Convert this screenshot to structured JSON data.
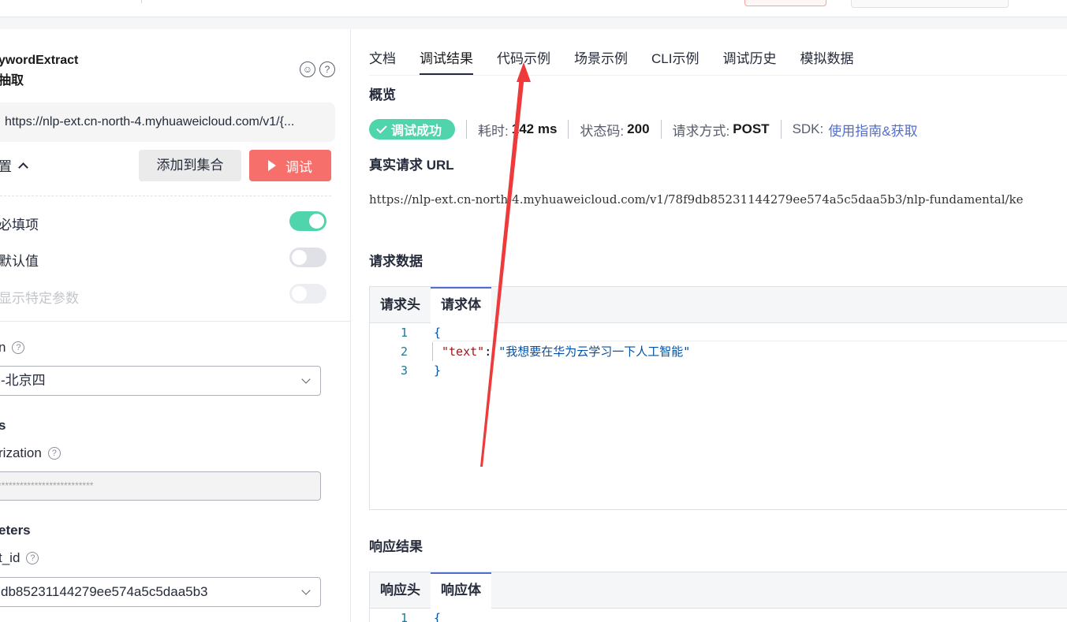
{
  "left": {
    "api_name_line1": "ywordExtract",
    "api_name_line2": "抽取",
    "url": "https://nlp-ext.cn-north-4.myhuaweicloud.com/v1/{...",
    "config_label": "置",
    "add_to_collection": "添加到集合",
    "debug": "调试",
    "toggles": [
      {
        "label": "必填项",
        "state": "on"
      },
      {
        "label": "默认值",
        "state": "off"
      },
      {
        "label": "显示特定参数",
        "state": "disabled"
      }
    ],
    "region_label": "n",
    "region_value": "-北京四",
    "headers_title": "s",
    "auth_label": "rization",
    "auth_value": "**************************",
    "params_title": "eters",
    "project_label": "t_id",
    "project_value": "db85231144279ee574a5c5daa5b3"
  },
  "tabs": [
    "文档",
    "调试结果",
    "代码示例",
    "场景示例",
    "CLI示例",
    "调试历史",
    "模拟数据"
  ],
  "active_tab": "调试结果",
  "overview": {
    "title": "概览",
    "status_badge": "调试成功",
    "time_label": "耗时:",
    "time_value": "142 ms",
    "code_label": "状态码:",
    "code_value": "200",
    "method_label": "请求方式:",
    "method_value": "POST",
    "sdk_label": "SDK:",
    "sdk_link": "使用指南&获取"
  },
  "real_url": {
    "title": "真实请求 URL",
    "value": "https://nlp-ext.cn-north-4.myhuaweicloud.com/v1/78f9db85231144279ee574a5c5daa5b3/nlp-fundamental/ke"
  },
  "request": {
    "title": "请求数据",
    "tab_header": "请求头",
    "tab_body": "请求体",
    "lines": [
      {
        "n": "1",
        "text": "{"
      },
      {
        "n": "2",
        "key": "\"text\"",
        "value": "\"我想要在华为云学习一下人工智能\""
      },
      {
        "n": "3",
        "text": "}"
      }
    ]
  },
  "response": {
    "title": "响应结果",
    "tab_header": "响应头",
    "tab_body": "响应体",
    "line1_n": "1",
    "line1_text": "{"
  },
  "icons": {
    "smile": "smiley-icon",
    "help": "help-icon",
    "annotation": "red-arrow"
  },
  "colors": {
    "accent_red": "#f66f6a",
    "success_green": "#50d4ab",
    "link_blue": "#526ecc",
    "arrow_red": "#ee3a3a"
  }
}
